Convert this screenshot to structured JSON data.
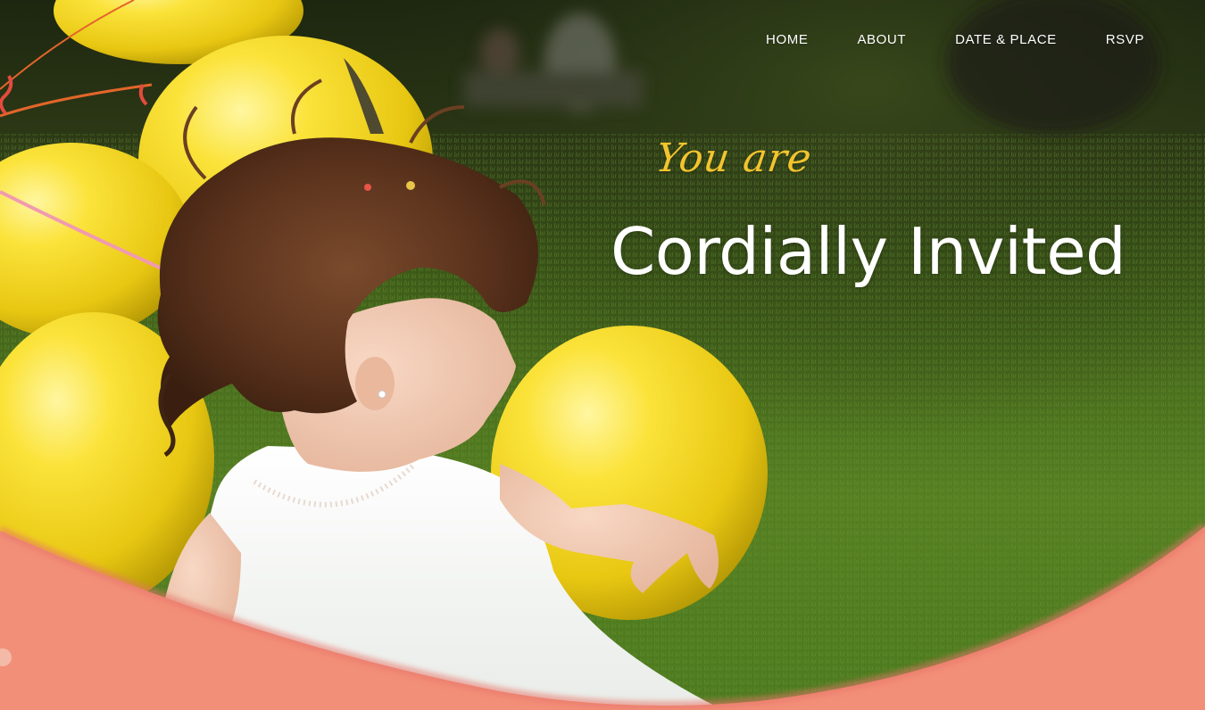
{
  "nav": {
    "items": [
      {
        "label": "HOME"
      },
      {
        "label": "ABOUT"
      },
      {
        "label": "DATE & PLACE"
      },
      {
        "label": "RSVP"
      }
    ]
  },
  "hero": {
    "eyebrow": "You are",
    "title": "Cordially Invited"
  },
  "colors": {
    "accent_yellow": "#f3c42e",
    "coral_wave": "#f28f78",
    "grass": "#4f7a1f",
    "nav_text": "#ffffff"
  }
}
